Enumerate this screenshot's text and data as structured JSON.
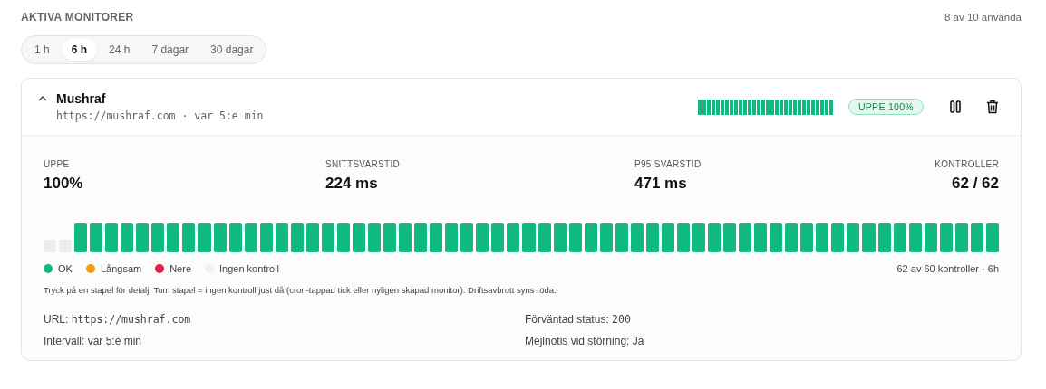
{
  "header": {
    "title": "AKTIVA MONITORER",
    "usage": "8 av 10 använda"
  },
  "ranges": [
    {
      "label": "1 h",
      "selected": false
    },
    {
      "label": "6 h",
      "selected": true
    },
    {
      "label": "24 h",
      "selected": false
    },
    {
      "label": "7 dagar",
      "selected": false
    },
    {
      "label": "30 dagar",
      "selected": false
    }
  ],
  "monitor": {
    "expanded": true,
    "name": "Mushraf",
    "subtitle": "https://mushraf.com · var 5:e min",
    "badge": "UPPE 100%",
    "stats": [
      {
        "label": "UPPE",
        "value": "100%"
      },
      {
        "label": "SNITTSVARSTID",
        "value": "224 ms"
      },
      {
        "label": "P95 SVARSTID",
        "value": "471 ms"
      },
      {
        "label": "KONTROLLER",
        "value": "62 / 62"
      }
    ],
    "bars": [
      {
        "color": "#ececec"
      },
      {
        "color": "#ececec"
      },
      {
        "color": "#10b981"
      },
      {
        "color": "#10b981"
      },
      {
        "color": "#10b981"
      },
      {
        "color": "#10b981"
      },
      {
        "color": "#10b981"
      },
      {
        "color": "#10b981"
      },
      {
        "color": "#10b981"
      },
      {
        "color": "#10b981"
      },
      {
        "color": "#10b981"
      },
      {
        "color": "#10b981"
      },
      {
        "color": "#10b981"
      },
      {
        "color": "#10b981"
      },
      {
        "color": "#10b981"
      },
      {
        "color": "#10b981"
      },
      {
        "color": "#10b981"
      },
      {
        "color": "#10b981"
      },
      {
        "color": "#10b981"
      },
      {
        "color": "#10b981"
      },
      {
        "color": "#10b981"
      },
      {
        "color": "#10b981"
      },
      {
        "color": "#10b981"
      },
      {
        "color": "#10b981"
      },
      {
        "color": "#10b981"
      },
      {
        "color": "#10b981"
      },
      {
        "color": "#10b981"
      },
      {
        "color": "#10b981"
      },
      {
        "color": "#10b981"
      },
      {
        "color": "#10b981"
      },
      {
        "color": "#10b981"
      },
      {
        "color": "#10b981"
      },
      {
        "color": "#10b981"
      },
      {
        "color": "#10b981"
      },
      {
        "color": "#10b981"
      },
      {
        "color": "#10b981"
      },
      {
        "color": "#10b981"
      },
      {
        "color": "#10b981"
      },
      {
        "color": "#10b981"
      },
      {
        "color": "#10b981"
      },
      {
        "color": "#10b981"
      },
      {
        "color": "#10b981"
      },
      {
        "color": "#10b981"
      },
      {
        "color": "#10b981"
      },
      {
        "color": "#10b981"
      },
      {
        "color": "#10b981"
      },
      {
        "color": "#10b981"
      },
      {
        "color": "#10b981"
      },
      {
        "color": "#10b981"
      },
      {
        "color": "#10b981"
      },
      {
        "color": "#10b981"
      },
      {
        "color": "#10b981"
      },
      {
        "color": "#10b981"
      },
      {
        "color": "#10b981"
      },
      {
        "color": "#10b981"
      },
      {
        "color": "#10b981"
      },
      {
        "color": "#10b981"
      },
      {
        "color": "#10b981"
      },
      {
        "color": "#10b981"
      },
      {
        "color": "#10b981"
      },
      {
        "color": "#10b981"
      },
      {
        "color": "#10b981"
      }
    ],
    "legend": [
      {
        "label": "OK",
        "color": "#10b981"
      },
      {
        "label": "Långsam",
        "color": "#f59e0b"
      },
      {
        "label": "Nere",
        "color": "#e11d48"
      },
      {
        "label": "Ingen kontroll",
        "color": "#f1f1f1"
      }
    ],
    "summary": "62 av 60 kontroller · 6h",
    "note": "Tryck på en stapel för detalj. Tom stapel = ingen kontroll just då (cron-tappad tick eller nyligen skapad monitor). Driftsavbrott syns röda.",
    "details": [
      {
        "label": "URL:",
        "value": "https://mushraf.com",
        "mono": true
      },
      {
        "label": "Förväntad status:",
        "value": "200",
        "mono": true
      },
      {
        "label": "Intervall:",
        "value": "var 5:e min",
        "mono": false
      },
      {
        "label": "Mejlnotis vid störning:",
        "value": "Ja",
        "mono": false
      }
    ]
  }
}
